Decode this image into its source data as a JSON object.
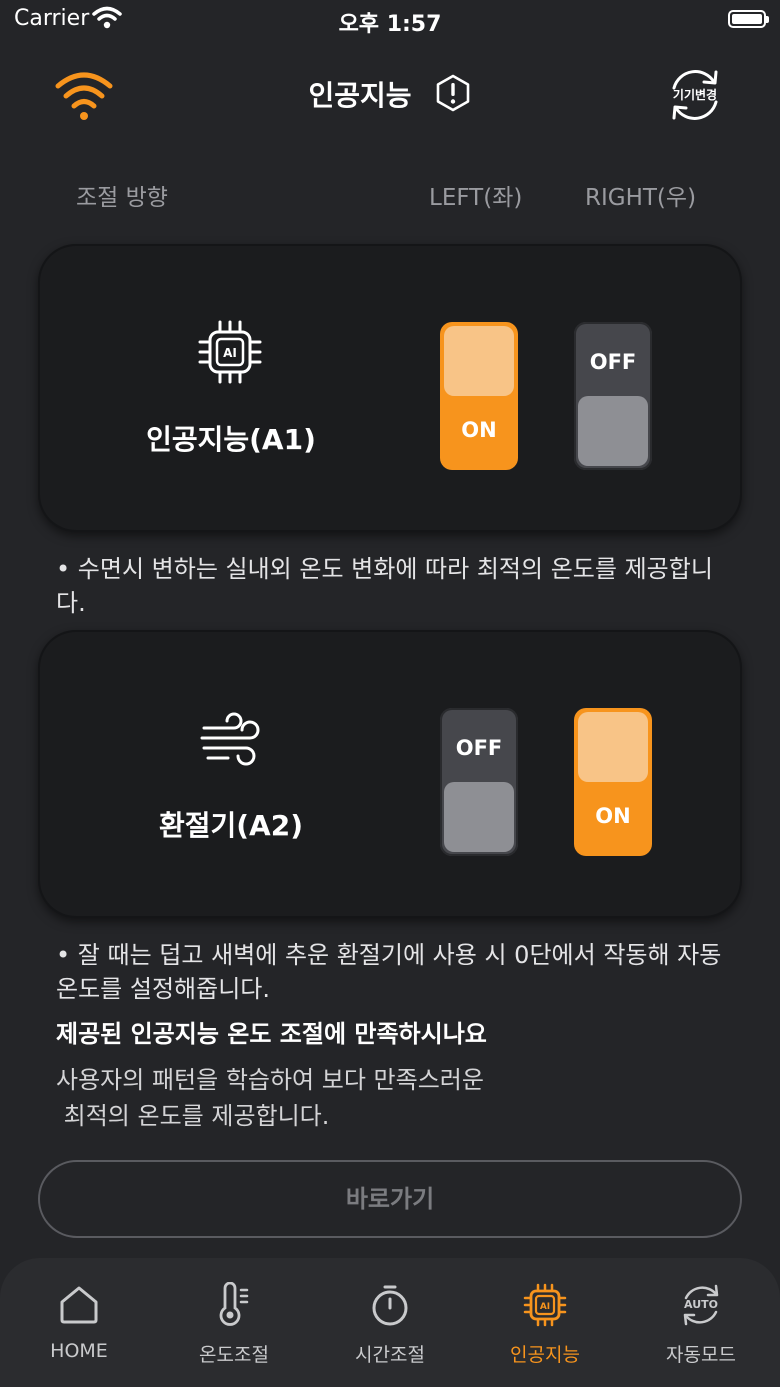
{
  "status_bar": {
    "carrier": "Carrier",
    "time": "오후 1:57"
  },
  "header": {
    "title": "인공지능",
    "device_change_label": "기기변경"
  },
  "direction": {
    "label": "조절 방향",
    "left": "LEFT(좌)",
    "right": "RIGHT(우)"
  },
  "cards": [
    {
      "name": "인공지능(A1)",
      "icon": "ai-chip-icon",
      "chip_text": "AI",
      "left_toggle": {
        "state": "on",
        "label": "ON"
      },
      "right_toggle": {
        "state": "off",
        "label": "OFF"
      }
    },
    {
      "name": "환절기(A2)",
      "icon": "wind-icon",
      "left_toggle": {
        "state": "off",
        "label": "OFF"
      },
      "right_toggle": {
        "state": "on",
        "label": "ON"
      }
    }
  ],
  "descriptions": {
    "ai": "• 수면시 변하는 실내외 온도 변화에 따라 최적의 온도를 제공합니다.",
    "season": "• 잘 때는 덥고 새벽에 추운 환절기에 사용 시 0단에서 작동해 자동 온도를 설정해줍니다."
  },
  "question": "제공된 인공지능 온도 조절에 만족하시나요",
  "sub_text": "사용자의 패턴을 학습하여 보다 만족스러운\n 최적의 온도를 제공합니다.",
  "go_button": "바로가기",
  "nav": {
    "items": [
      {
        "label": "HOME",
        "icon": "home-icon"
      },
      {
        "label": "온도조절",
        "icon": "thermometer-icon"
      },
      {
        "label": "시간조절",
        "icon": "timer-icon"
      },
      {
        "label": "인공지능",
        "icon": "ai-chip-icon",
        "active": true
      },
      {
        "label": "자동모드",
        "icon": "auto-icon",
        "icon_text": "AUTO"
      }
    ]
  },
  "colors": {
    "accent": "#f7941d",
    "background": "#242528",
    "card": "#1b1c1e"
  }
}
